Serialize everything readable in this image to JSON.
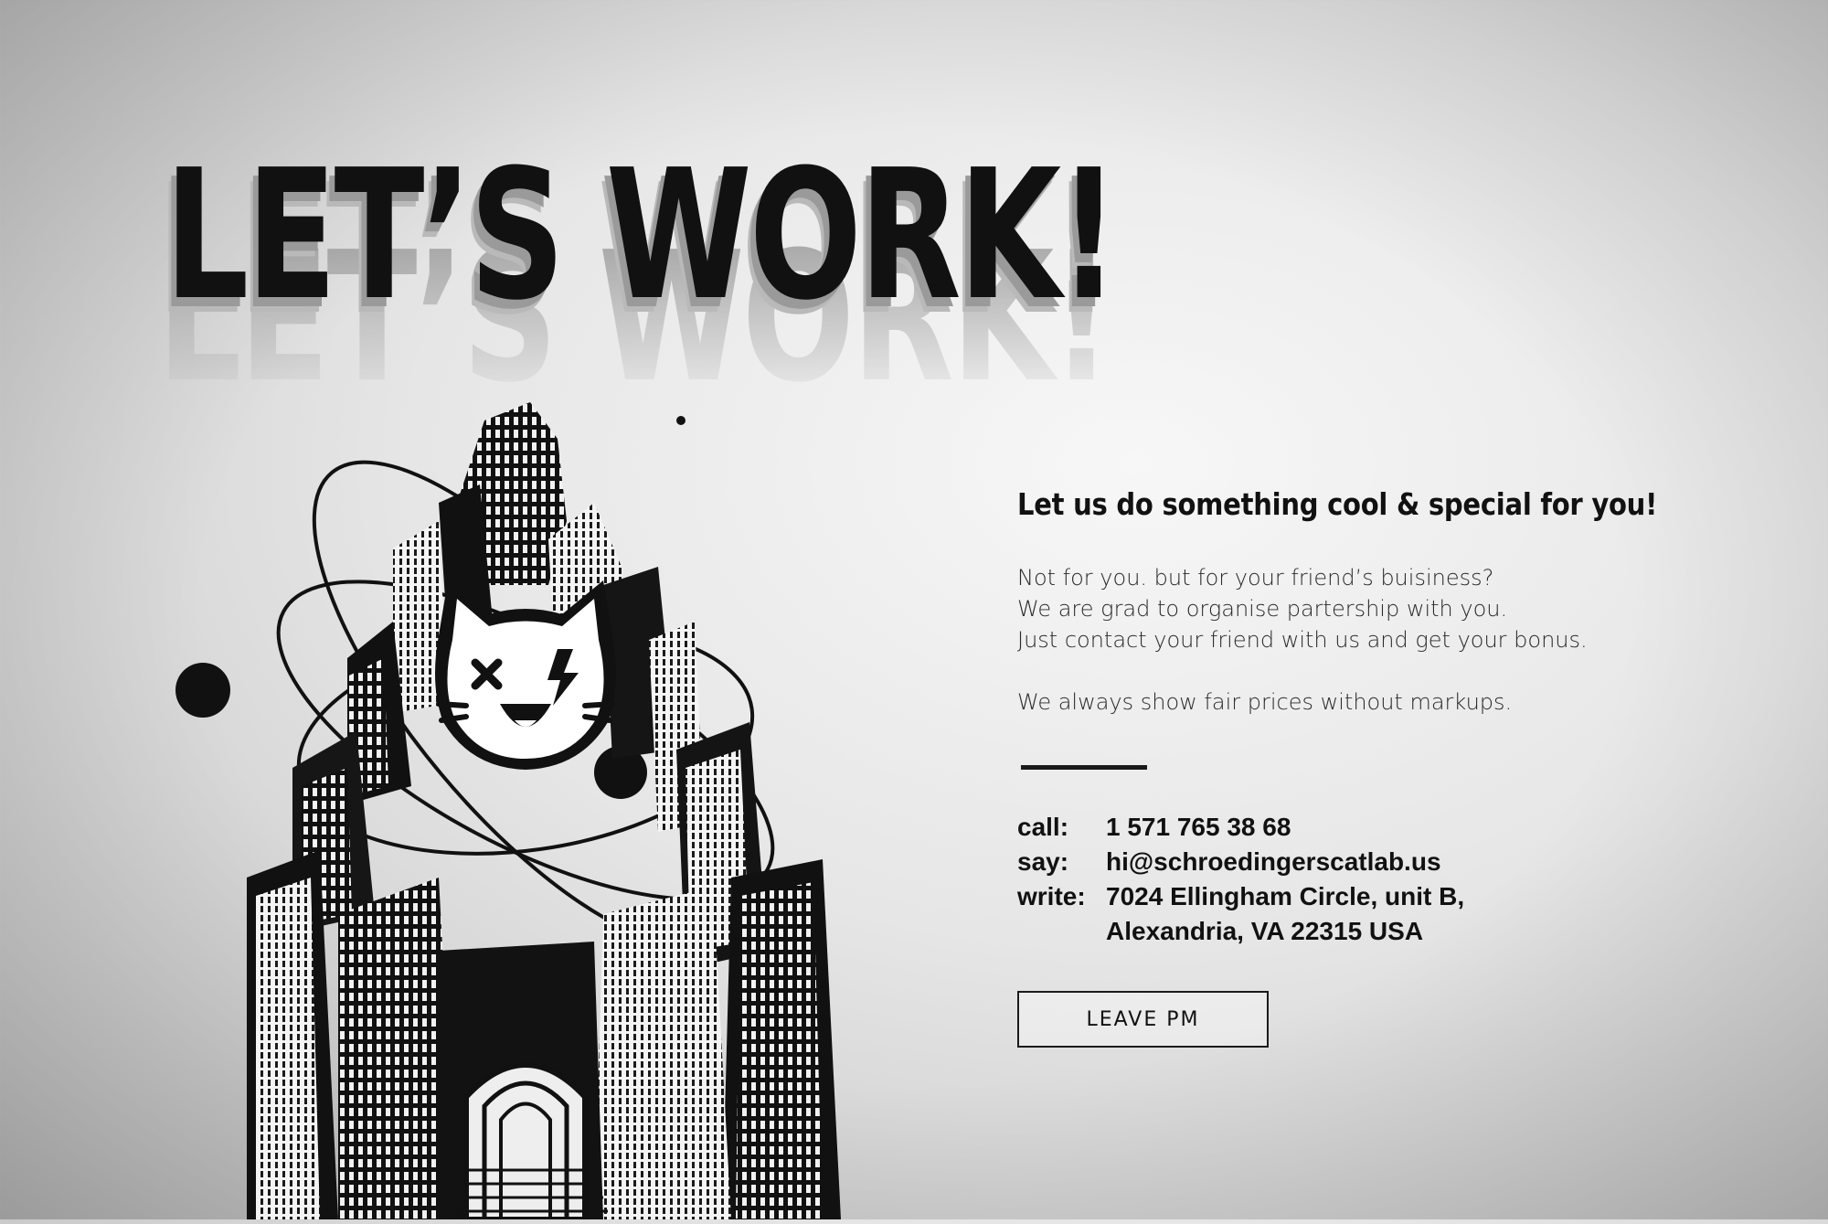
{
  "headline": "LET’S WORK!",
  "tagline": "Let us do something cool & special for you!",
  "intro_lines": [
    "Not for you. but for your friend’s buisiness?",
    "We are grad to organise partership with you.",
    "Just contact your friend with us and get your bonus."
  ],
  "fair_prices": "We always show fair prices without markups.",
  "contacts": {
    "call": {
      "label": "call:",
      "value": "1 571 765 38 68"
    },
    "say": {
      "label": "say:",
      "value": "hi@schroedingerscatlab.us"
    },
    "write": {
      "label": "write:",
      "line1": "7024 Ellingham Circle, unit B,",
      "line2": "Alexandria, VA 22315 USA"
    }
  },
  "cta_label": "LEAVE PM",
  "icons": {
    "illustration": "atom-city-cat-illustration",
    "cat": "cat-face-icon"
  },
  "colors": {
    "ink": "#111111",
    "paper": "#e6e6e6"
  }
}
